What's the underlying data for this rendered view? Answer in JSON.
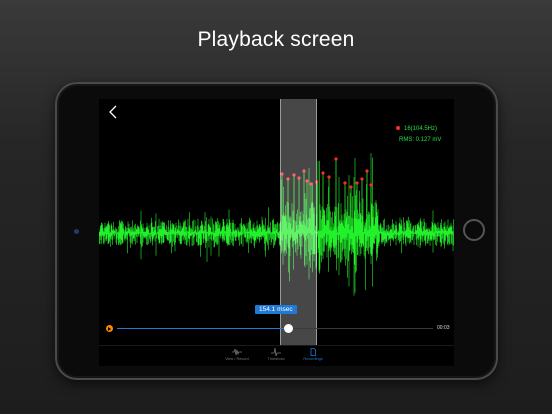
{
  "headline": "Playback screen",
  "legend": {
    "peak_text": "16(104.5Hz)",
    "rms_text": "RMS: 0.127 mV"
  },
  "badge": "154.1 msec",
  "time_label": "00:03",
  "playback": {
    "progress": 0.54
  },
  "tabs": [
    {
      "label": "View / Record",
      "icon": "waveform-icon",
      "active": false
    },
    {
      "label": "Threshold",
      "icon": "spike-icon",
      "active": false
    },
    {
      "label": "Recordings",
      "icon": "document-icon",
      "active": true
    }
  ],
  "colors": {
    "waveform": "#22f02a",
    "peaks": "#ff2a2a",
    "accent": "#1f7ad6",
    "play": "#ff8a00"
  }
}
